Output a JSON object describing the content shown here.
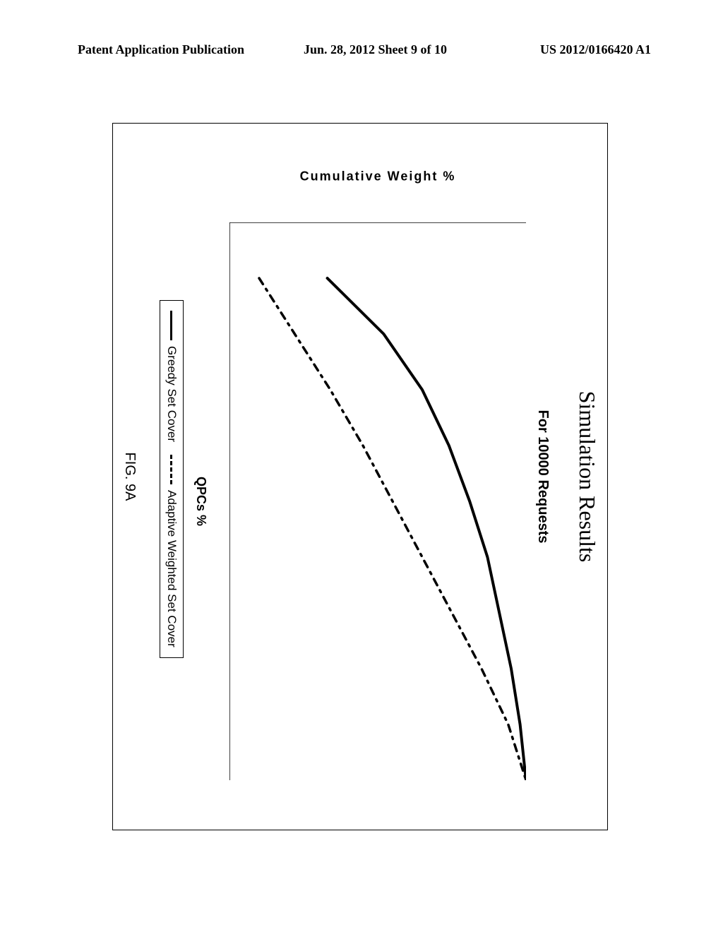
{
  "header": {
    "left": "Patent Application Publication",
    "center": "Jun. 28, 2012  Sheet 9 of 10",
    "right": "US 2012/0166420 A1"
  },
  "figure": {
    "sim_title": "Simulation Results",
    "sub_title": "For 10000 Requests",
    "ylabel": "Cumulative Weight %",
    "xlabel": "QPCs %",
    "legend": {
      "solid": "Greedy Set Cover",
      "dashed": "Adaptive Weighted Set Cover"
    },
    "fig_label": "FIG. 9A"
  },
  "chart_data": {
    "type": "line",
    "title": "Simulation Results",
    "subtitle": "For 10000 Requests",
    "xlabel": "QPCs %",
    "ylabel": "Cumulative Weight %",
    "xlim": [
      0,
      100
    ],
    "ylim": [
      0,
      100
    ],
    "x_ticks": [
      0,
      10,
      20,
      30,
      40,
      50,
      60,
      70,
      80,
      90,
      100
    ],
    "y_ticks": [
      0,
      10,
      20,
      30,
      40,
      50,
      60,
      70,
      80,
      90,
      100
    ],
    "series": [
      {
        "name": "Greedy Set Cover",
        "style": "solid",
        "x": [
          10,
          20,
          30,
          40,
          50,
          60,
          70,
          80,
          90,
          100
        ],
        "values": [
          33,
          52,
          65,
          74,
          81,
          87,
          91,
          95,
          98,
          100
        ]
      },
      {
        "name": "Adaptive Weighted Set Cover",
        "style": "dashed",
        "x": [
          10,
          20,
          30,
          40,
          50,
          60,
          70,
          80,
          90,
          100
        ],
        "values": [
          10,
          22,
          34,
          45,
          55,
          65,
          75,
          85,
          94,
          100
        ]
      }
    ]
  }
}
